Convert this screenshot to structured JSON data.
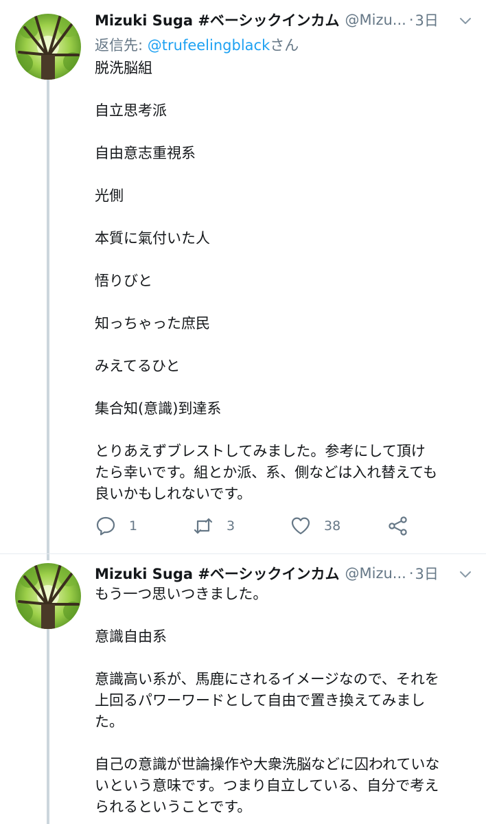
{
  "tweets": [
    {
      "author": {
        "name": "Mizuki Suga #ベーシックインカム",
        "handle": "@Mizu..."
      },
      "separator": "·",
      "time": "3日",
      "reply_to": {
        "prefix": "返信先: ",
        "user": "@trufeelingblack",
        "suffix": "さん"
      },
      "text": "脱洗脳組\n\n自立思考派\n\n自由意志重視系\n\n光側\n\n本質に氣付いた人\n\n悟りびと\n\n知っちゃった庶民\n\nみえてるひと\n\n集合知(意識)到達系\n\nとりあえずブレストしてみました。参考にして頂け\nたら幸いです。組とか派、系、側などは入れ替えても\n良いかもしれないです。",
      "actions": {
        "replies": "1",
        "retweets": "3",
        "likes": "38"
      }
    },
    {
      "author": {
        "name": "Mizuki Suga #ベーシックインカム",
        "handle": "@Mizu..."
      },
      "separator": "·",
      "time": "3日",
      "text": "もう一つ思いつきました。\n\n意識自由系\n\n意識高い系が、馬鹿にされるイメージなので、それを\n上回るパワーワードとして自由で置き換えてみまし\nた。\n\n自己の意識が世論操作や大衆洗脳などに囚われていな\nいという意味です。つまり自立している、自分で考え\nられるということです。"
    }
  ],
  "icons": {
    "reply": "reply-icon",
    "retweet": "retweet-icon",
    "like": "heart-icon",
    "share": "share-icon",
    "more": "chevron-down-icon"
  },
  "colors": {
    "link": "#1da1f2",
    "secondary": "#657786",
    "thread_line": "#ccd6dd"
  }
}
